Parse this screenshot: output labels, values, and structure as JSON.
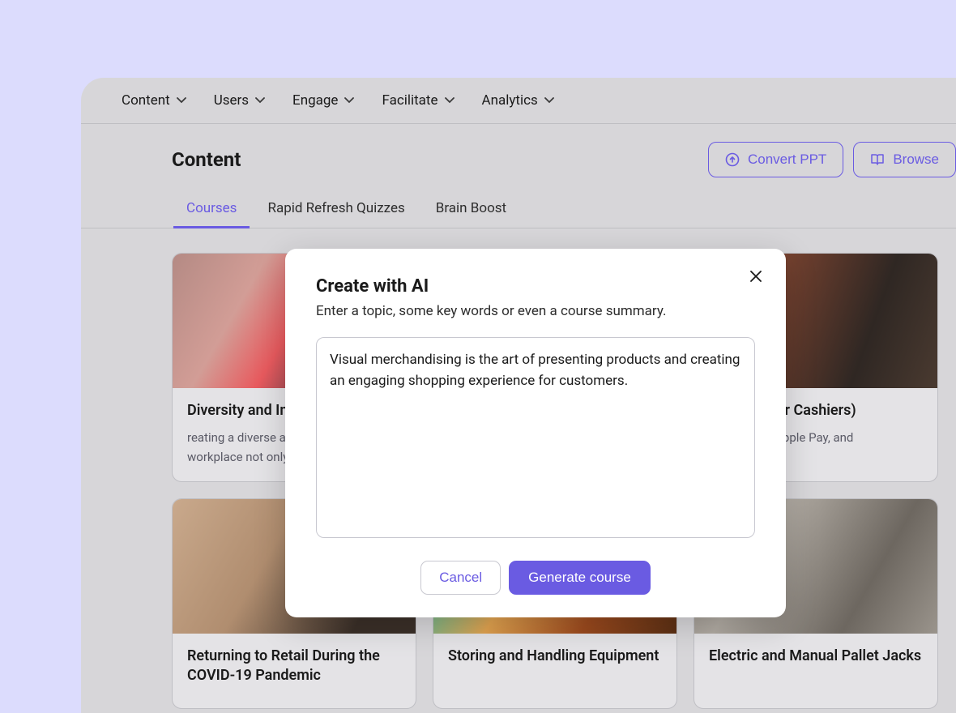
{
  "nav": {
    "items": [
      {
        "label": "Content"
      },
      {
        "label": "Users"
      },
      {
        "label": "Engage"
      },
      {
        "label": "Facilitate"
      },
      {
        "label": "Analytics"
      }
    ]
  },
  "header": {
    "title": "Content",
    "convert_label": "Convert PPT",
    "browse_label": "Browse"
  },
  "tabs": [
    {
      "label": "Courses",
      "active": true
    },
    {
      "label": "Rapid Refresh Quizzes",
      "active": false
    },
    {
      "label": "Brain Boost",
      "active": false
    }
  ],
  "courses": [
    {
      "title": "Diversity and Inclusion in Retail",
      "desc": "reating a diverse and inclusive workplace not only makes us stronger…"
    },
    {
      "title": "",
      "desc": ""
    },
    {
      "title": "Security (for Cashiers)",
      "desc": "use Square, Apple Pay, and contactless…"
    },
    {
      "title": "Returning to Retail During the COVID-19 Pandemic",
      "desc": ""
    },
    {
      "title": "Storing and Handling Equipment",
      "desc": ""
    },
    {
      "title": "Electric and Manual Pallet Jacks",
      "desc": ""
    }
  ],
  "modal": {
    "title": "Create with AI",
    "subtitle": "Enter a topic, some key words or even a course summary.",
    "value": "Visual merchandising is the art of presenting products and creating an engaging shopping experience for customers.",
    "cancel_label": "Cancel",
    "generate_label": "Generate course"
  },
  "colors": {
    "accent": "#6a5be2",
    "page_bg": "#dcdcfd",
    "window_bg": "#d7d6d9"
  }
}
